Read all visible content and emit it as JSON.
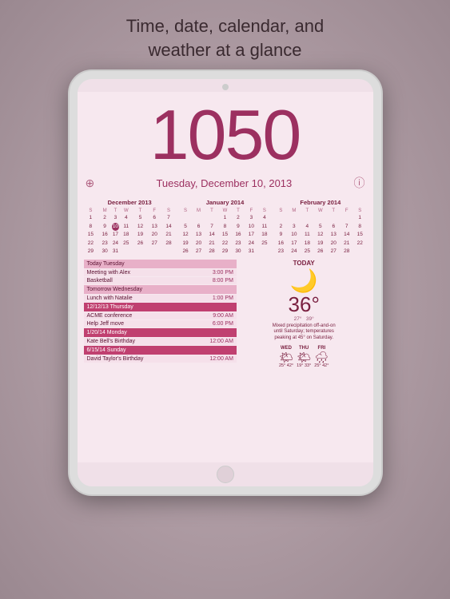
{
  "tagline": {
    "line1": "Time, date, calendar, and",
    "line2": "weather at a glance"
  },
  "screen": {
    "time": "1050",
    "date": "Tuesday, December 10, 2013",
    "plus_icon": "⊕",
    "info_icon": "ⓘ",
    "calendars": [
      {
        "title": "December 2013",
        "headers": [
          "S",
          "M",
          "T",
          "W",
          "T",
          "F",
          "S"
        ],
        "weeks": [
          [
            "1",
            "2",
            "3",
            "4",
            "5",
            "6",
            "7"
          ],
          [
            "8",
            "9",
            "10",
            "11",
            "12",
            "13",
            "14"
          ],
          [
            "15",
            "16",
            "17",
            "18",
            "19",
            "20",
            "21"
          ],
          [
            "22",
            "23",
            "24",
            "25",
            "26",
            "27",
            "28"
          ],
          [
            "29",
            "30",
            "31",
            "",
            "",
            "",
            ""
          ]
        ],
        "today": "10"
      },
      {
        "title": "January 2014",
        "headers": [
          "S",
          "M",
          "T",
          "W",
          "T",
          "F",
          "S"
        ],
        "weeks": [
          [
            "",
            "",
            "",
            "1",
            "2",
            "3",
            "4"
          ],
          [
            "5",
            "6",
            "7",
            "8",
            "9",
            "10",
            "11"
          ],
          [
            "12",
            "13",
            "14",
            "15",
            "16",
            "17",
            "18"
          ],
          [
            "19",
            "20",
            "21",
            "22",
            "23",
            "24",
            "25"
          ],
          [
            "26",
            "27",
            "28",
            "29",
            "30",
            "31",
            ""
          ]
        ],
        "today": null
      },
      {
        "title": "February 2014",
        "headers": [
          "S",
          "M",
          "T",
          "W",
          "T",
          "F",
          "S"
        ],
        "weeks": [
          [
            "",
            "",
            "",
            "",
            "",
            "",
            "1"
          ],
          [
            "2",
            "3",
            "4",
            "5",
            "6",
            "7",
            "8"
          ],
          [
            "9",
            "10",
            "11",
            "12",
            "13",
            "14",
            "15"
          ],
          [
            "16",
            "17",
            "18",
            "19",
            "20",
            "21",
            "22"
          ],
          [
            "23",
            "24",
            "25",
            "26",
            "27",
            "28",
            ""
          ]
        ],
        "today": null
      }
    ],
    "events": [
      {
        "type": "header",
        "label": "Today Tuesday",
        "style": "light"
      },
      {
        "type": "event",
        "name": "Meeting with Alex",
        "time": "3:00 PM"
      },
      {
        "type": "event",
        "name": "Basketball",
        "time": "8:00 PM"
      },
      {
        "type": "header",
        "label": "Tomorrow Wednesday",
        "style": "light"
      },
      {
        "type": "event",
        "name": "Lunch with Natalie",
        "time": "1:00 PM"
      },
      {
        "type": "header",
        "label": "12/12/13 Thursday",
        "style": "dark"
      },
      {
        "type": "event",
        "name": "ACME conference",
        "time": "9:00 AM"
      },
      {
        "type": "event",
        "name": "Help Jeff move",
        "time": "6:00 PM"
      },
      {
        "type": "header",
        "label": "1/20/14 Monday",
        "style": "dark"
      },
      {
        "type": "event",
        "name": "Kate Bell's Birthday",
        "time": "12:00 AM"
      },
      {
        "type": "header",
        "label": "6/15/14 Sunday",
        "style": "dark"
      },
      {
        "type": "event",
        "name": "David Taylor's Birthday",
        "time": "12:00 AM"
      }
    ],
    "weather": {
      "today_label": "TODAY",
      "main_icon": "🌙",
      "temp": "36°",
      "lo": "27°",
      "hi": "39°",
      "description": "Mixed precipitation off-and-on until Saturday; temperatures peaking at 45° on Saturday.",
      "days": [
        {
          "label": "WED",
          "icon": "🌤",
          "lo": "25°",
          "hi": "42°"
        },
        {
          "label": "THU",
          "icon": "🌤",
          "lo": "19°",
          "hi": "33°"
        },
        {
          "label": "FRI",
          "icon": "🌧",
          "lo": "25°",
          "hi": "42°"
        }
      ]
    }
  }
}
